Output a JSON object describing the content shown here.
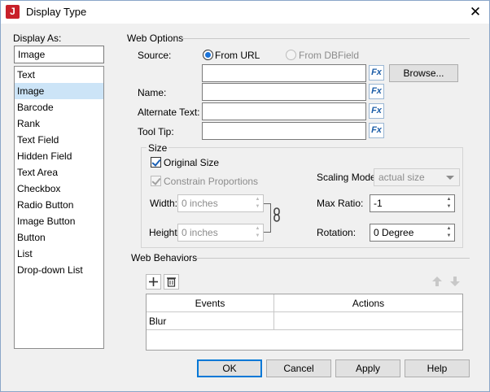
{
  "window": {
    "title": "Display Type",
    "app_icon_letter": "J"
  },
  "display_as": {
    "label": "Display As:",
    "value": "Image",
    "items": [
      "Text",
      "Image",
      "Barcode",
      "Rank",
      "Text Field",
      "Hidden Field",
      "Text Area",
      "Checkbox",
      "Radio Button",
      "Image Button",
      "Button",
      "List",
      "Drop-down List"
    ],
    "selected_index": 1
  },
  "web_options": {
    "group_label": "Web Options",
    "source_label": "Source:",
    "from_url_label": "From URL",
    "from_dbfield_label": "From DBField",
    "source_value": "",
    "browse_label": "Browse...",
    "name_label": "Name:",
    "name_value": "",
    "alt_text_label": "Alternate Text:",
    "alt_text_value": "",
    "tooltip_label": "Tool Tip:",
    "tooltip_value": "",
    "fx_label": "Fx"
  },
  "size": {
    "group_label": "Size",
    "original_size_label": "Original Size",
    "original_size_checked": true,
    "constrain_label": "Constrain Proportions",
    "constrain_checked": true,
    "width_label": "Width:",
    "width_value": "0 inches",
    "height_label": "Height:",
    "height_value": "0 inches",
    "scaling_mode_label": "Scaling Mode:",
    "scaling_mode_value": "actual size",
    "max_ratio_label": "Max Ratio:",
    "max_ratio_value": "-1",
    "rotation_label": "Rotation:",
    "rotation_value": "0 Degree"
  },
  "web_behaviors": {
    "group_label": "Web Behaviors",
    "columns": [
      "Events",
      "Actions"
    ],
    "rows": [
      {
        "event": "Blur",
        "action": ""
      }
    ]
  },
  "footer": {
    "ok_label": "OK",
    "cancel_label": "Cancel",
    "apply_label": "Apply",
    "help_label": "Help"
  },
  "colors": {
    "selection": "#cce4f7",
    "accent": "#0078d7",
    "app_icon": "#c8202a"
  }
}
